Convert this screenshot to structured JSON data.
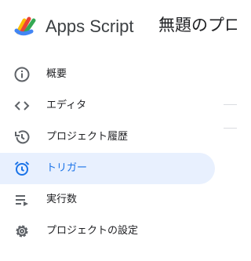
{
  "header": {
    "app_name": "Apps Script",
    "project_title": "無題のプロジェクト",
    "logo_icon": "apps-script-logo"
  },
  "sidebar": {
    "items": [
      {
        "label": "概要",
        "icon": "info-icon",
        "active": false
      },
      {
        "label": "エディタ",
        "icon": "code-icon",
        "active": false
      },
      {
        "label": "プロジェクト履歴",
        "icon": "history-icon",
        "active": false
      },
      {
        "label": "トリガー",
        "icon": "alarm-icon",
        "active": true
      },
      {
        "label": "実行数",
        "icon": "executions-icon",
        "active": false
      },
      {
        "label": "プロジェクトの設定",
        "icon": "gear-icon",
        "active": false
      }
    ]
  },
  "colors": {
    "accent": "#1a73e8",
    "active_bg": "#e8f0fe",
    "icon": "#5f6368"
  }
}
